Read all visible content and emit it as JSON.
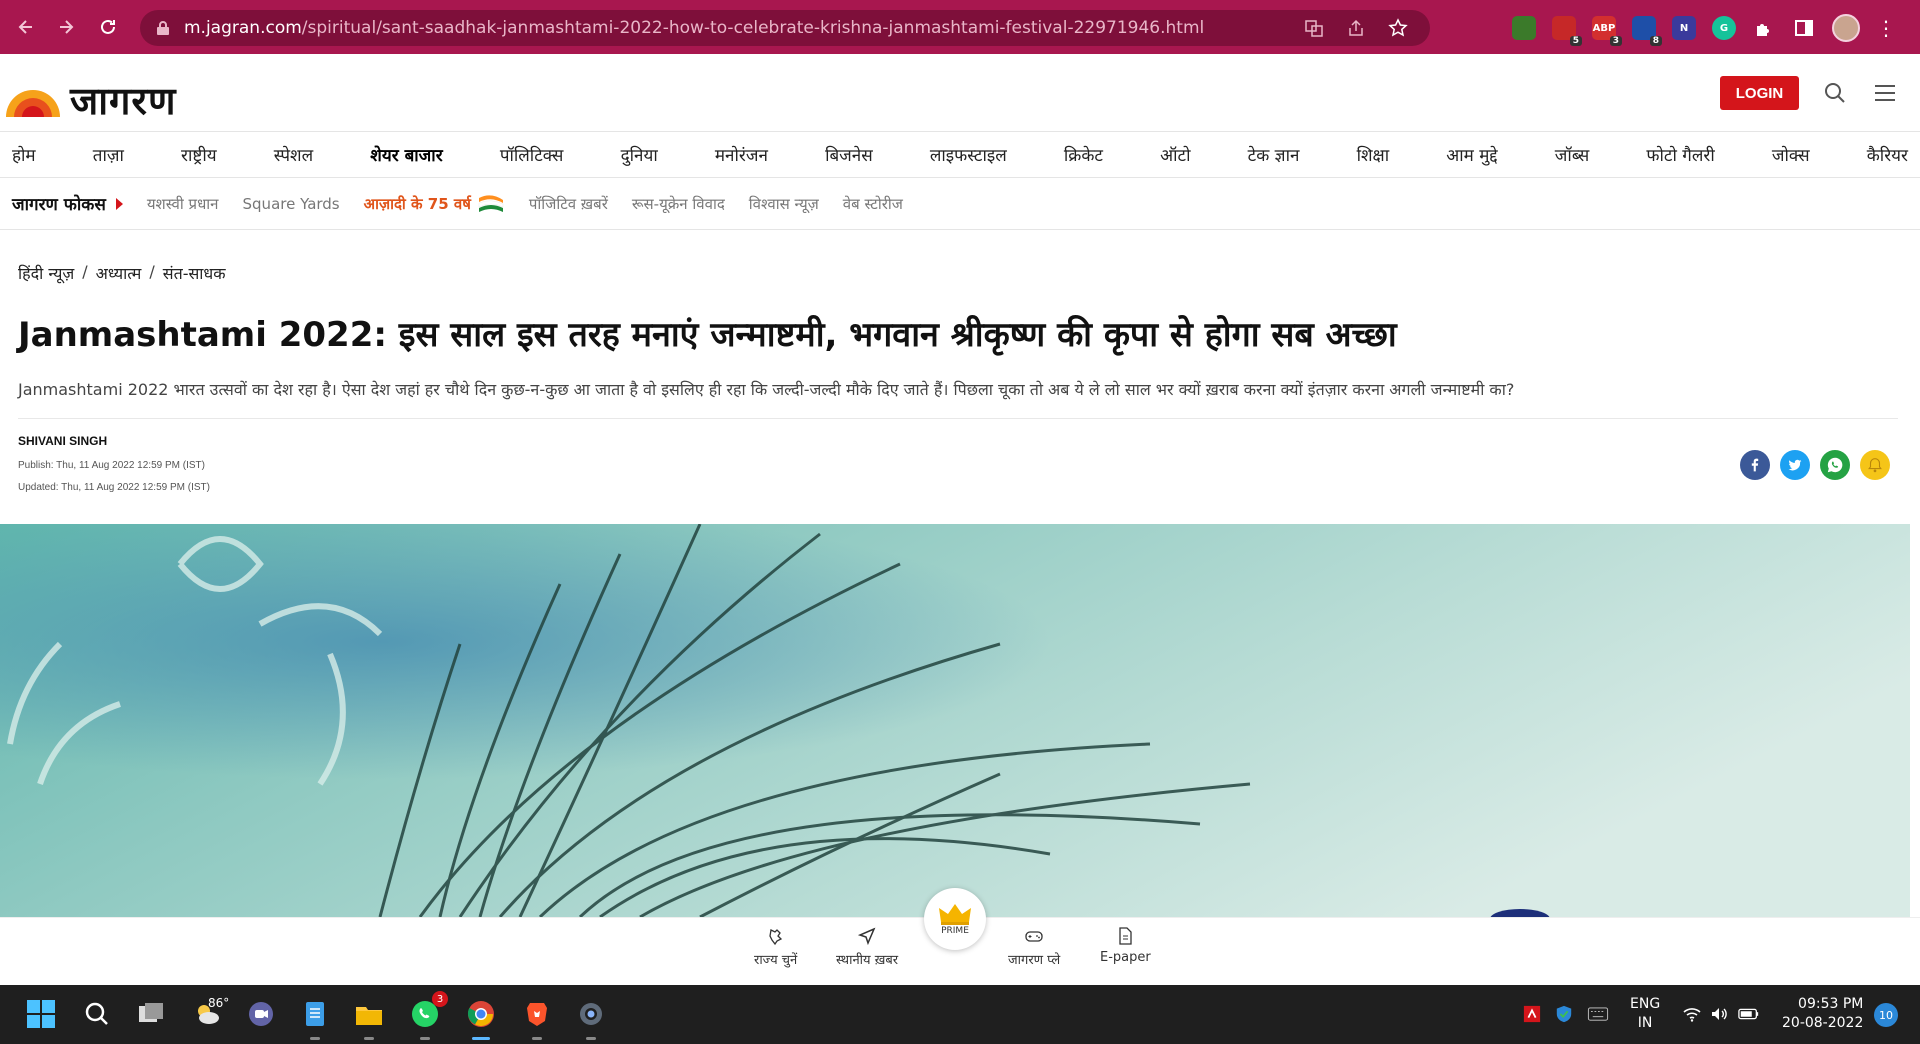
{
  "browser": {
    "url_host": "m.jagran.com",
    "url_path": "/spiritual/sant-saadhak-janmashtami-2022-how-to-celebrate-krishna-janmashtami-festival-22971946.html",
    "extensions": [
      {
        "name": "ext-1-icon",
        "badge": ""
      },
      {
        "name": "ext-2-icon",
        "badge": "5"
      },
      {
        "name": "adblock-icon",
        "label": "ABP",
        "badge": "3"
      },
      {
        "name": "ext-4-icon",
        "badge": "8"
      },
      {
        "name": "ext-5-icon",
        "label": "N",
        "badge": ""
      },
      {
        "name": "grammarly-icon",
        "label": "G",
        "badge": ""
      }
    ]
  },
  "site": {
    "logo_text": "जागरण",
    "login_label": "LOGIN"
  },
  "nav": {
    "items": [
      "होम",
      "ताज़ा",
      "राष्ट्रीय",
      "स्पेशल",
      "शेयर बाजार",
      "पॉलिटिक्स",
      "दुनिया",
      "मनोरंजन",
      "बिजनेस",
      "लाइफस्टाइल",
      "क्रिकेट",
      "ऑटो",
      "टेक ज्ञान",
      "शिक्षा",
      "आम मुद्दे",
      "जॉब्स",
      "फोटो गैलरी",
      "जोक्स",
      "कैरियर"
    ]
  },
  "focus": {
    "title": "जागरण फोकस",
    "items": [
      "यशस्वी प्रधान",
      "Square Yards",
      "आज़ादी के 75 वर्ष",
      "पॉजिटिव ख़बरें",
      "रूस-यूक्रेन विवाद",
      "विश्वास न्यूज़",
      "वेब स्टोरीज"
    ]
  },
  "article": {
    "breadcrumb": [
      "हिंदी न्यूज़",
      "अध्यात्म",
      "संत-साधक"
    ],
    "breadcrumb_sep": "/",
    "headline": "Janmashtami 2022: इस साल इस तरह मनाएं जन्माष्टमी, भगवान श्रीकृष्ण की कृपा से होगा सब अच्छा",
    "summary": "Janmashtami 2022 भारत उत्सवों का देश रहा है। ऐसा देश जहां हर चौथे दिन कुछ-न-कुछ आ जाता है वो इसलिए ही रहा कि जल्दी-जल्दी मौके दिए जाते हैं। पिछला चूका तो अब ये ले लो साल भर क्यों ख़राब करना क्यों इंतज़ार करना अगली जन्माष्टमी का?",
    "author": "SHIVANI SINGH",
    "published": "Publish: Thu, 11 Aug 2022 12:59 PM (IST)",
    "updated": "Updated: Thu, 11 Aug 2022 12:59 PM (IST)"
  },
  "bottom_bar": {
    "state_label": "राज्य चुनें",
    "local_label": "स्थानीय ख़बर",
    "prime_label": "PRIME",
    "play_label": "जागरण प्ले",
    "epaper_label": "E-paper"
  },
  "taskbar": {
    "weather": "86°",
    "whatsapp_badge": "3",
    "lang_line1": "ENG",
    "lang_line2": "IN",
    "time": "09:53 PM",
    "date": "20-08-2022",
    "notifications": "10"
  },
  "colors": {
    "browser_chrome": "#a8174f",
    "brand_red": "#d4151b",
    "focus_orange": "#e0551b"
  }
}
